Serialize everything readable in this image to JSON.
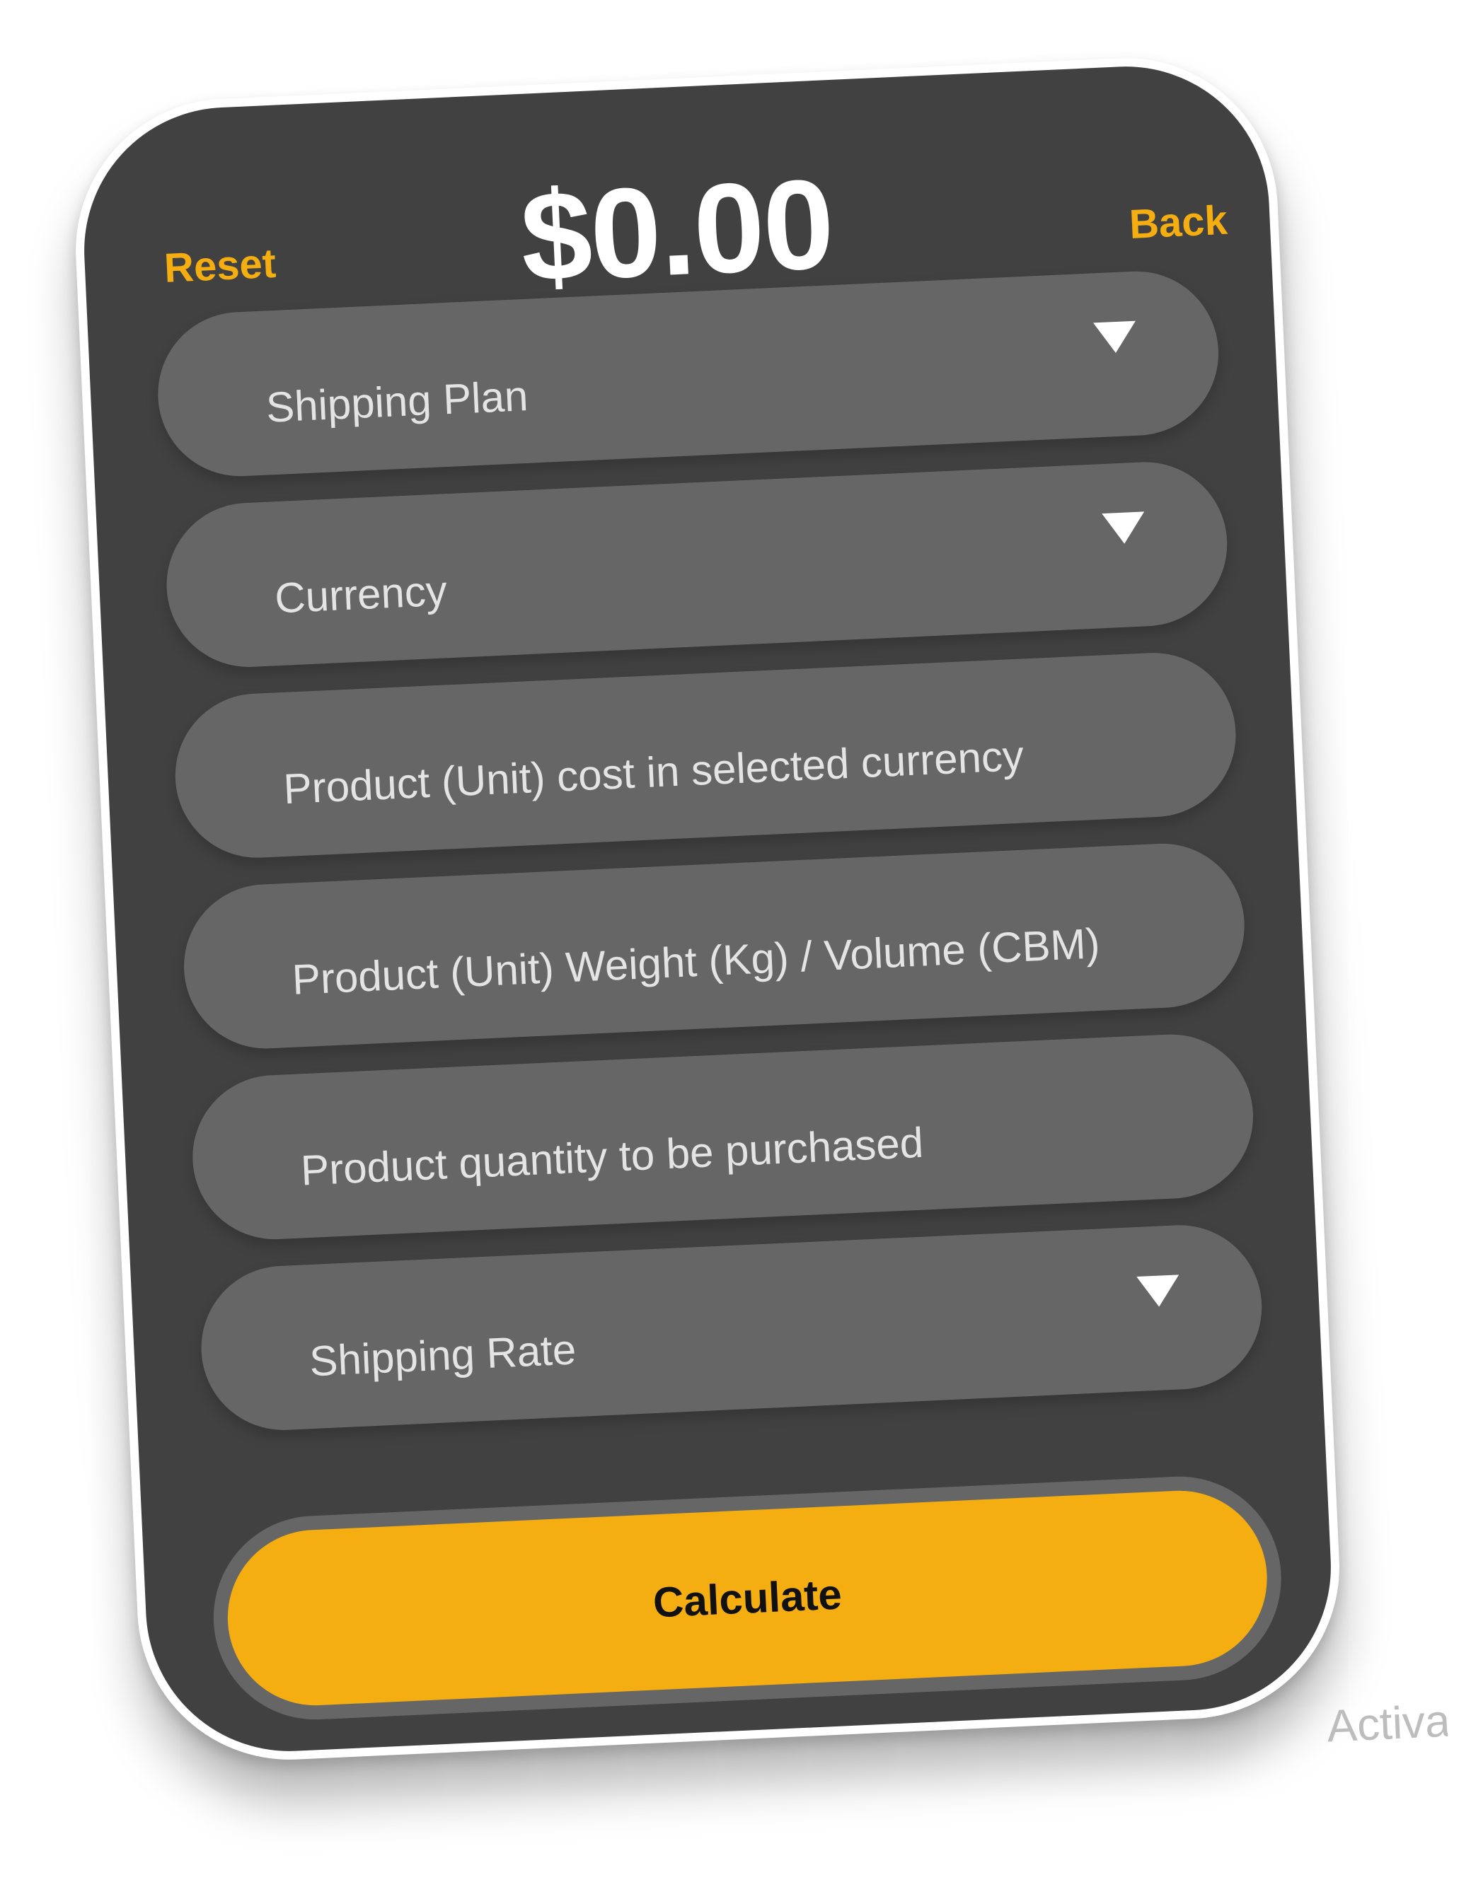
{
  "header": {
    "reset_label": "Reset",
    "total_amount": "$0.00",
    "back_label": "Back"
  },
  "form": {
    "shipping_plan_placeholder": "Shipping Plan",
    "currency_placeholder": "Currency",
    "unit_cost_placeholder": "Product (Unit) cost in selected currency",
    "unit_weight_placeholder": "Product (Unit) Weight (Kg) / Volume (CBM)",
    "quantity_placeholder": "Product quantity to be purchased",
    "shipping_rate_placeholder": "Shipping Rate"
  },
  "actions": {
    "calculate_label": "Calculate"
  },
  "overlay": {
    "watermark_text": "Activa"
  },
  "colors": {
    "card_background": "#414141",
    "field_background": "#666666",
    "accent": "#f5ae11"
  },
  "icons": {
    "dropdown": "caret-down-icon"
  }
}
